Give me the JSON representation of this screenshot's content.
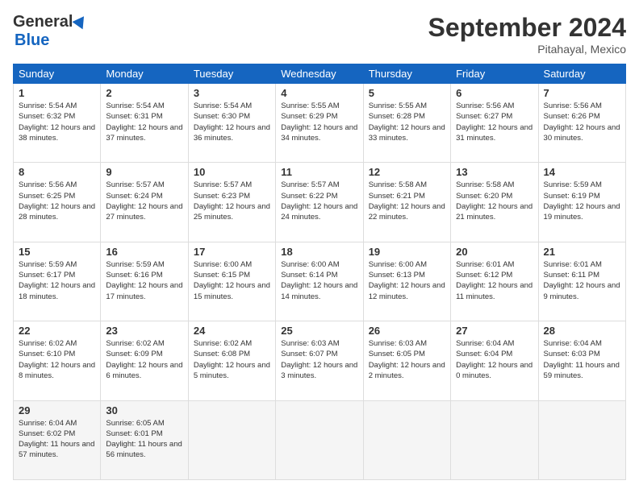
{
  "logo": {
    "general": "General",
    "blue": "Blue"
  },
  "title": "September 2024",
  "location": "Pitahayal, Mexico",
  "days_header": [
    "Sunday",
    "Monday",
    "Tuesday",
    "Wednesday",
    "Thursday",
    "Friday",
    "Saturday"
  ],
  "weeks": [
    [
      {
        "day": "1",
        "sunrise": "5:54 AM",
        "sunset": "6:32 PM",
        "daylight": "12 hours and 38 minutes."
      },
      {
        "day": "2",
        "sunrise": "5:54 AM",
        "sunset": "6:31 PM",
        "daylight": "12 hours and 37 minutes."
      },
      {
        "day": "3",
        "sunrise": "5:54 AM",
        "sunset": "6:30 PM",
        "daylight": "12 hours and 36 minutes."
      },
      {
        "day": "4",
        "sunrise": "5:55 AM",
        "sunset": "6:29 PM",
        "daylight": "12 hours and 34 minutes."
      },
      {
        "day": "5",
        "sunrise": "5:55 AM",
        "sunset": "6:28 PM",
        "daylight": "12 hours and 33 minutes."
      },
      {
        "day": "6",
        "sunrise": "5:56 AM",
        "sunset": "6:27 PM",
        "daylight": "12 hours and 31 minutes."
      },
      {
        "day": "7",
        "sunrise": "5:56 AM",
        "sunset": "6:26 PM",
        "daylight": "12 hours and 30 minutes."
      }
    ],
    [
      {
        "day": "8",
        "sunrise": "5:56 AM",
        "sunset": "6:25 PM",
        "daylight": "12 hours and 28 minutes."
      },
      {
        "day": "9",
        "sunrise": "5:57 AM",
        "sunset": "6:24 PM",
        "daylight": "12 hours and 27 minutes."
      },
      {
        "day": "10",
        "sunrise": "5:57 AM",
        "sunset": "6:23 PM",
        "daylight": "12 hours and 25 minutes."
      },
      {
        "day": "11",
        "sunrise": "5:57 AM",
        "sunset": "6:22 PM",
        "daylight": "12 hours and 24 minutes."
      },
      {
        "day": "12",
        "sunrise": "5:58 AM",
        "sunset": "6:21 PM",
        "daylight": "12 hours and 22 minutes."
      },
      {
        "day": "13",
        "sunrise": "5:58 AM",
        "sunset": "6:20 PM",
        "daylight": "12 hours and 21 minutes."
      },
      {
        "day": "14",
        "sunrise": "5:59 AM",
        "sunset": "6:19 PM",
        "daylight": "12 hours and 19 minutes."
      }
    ],
    [
      {
        "day": "15",
        "sunrise": "5:59 AM",
        "sunset": "6:17 PM",
        "daylight": "12 hours and 18 minutes."
      },
      {
        "day": "16",
        "sunrise": "5:59 AM",
        "sunset": "6:16 PM",
        "daylight": "12 hours and 17 minutes."
      },
      {
        "day": "17",
        "sunrise": "6:00 AM",
        "sunset": "6:15 PM",
        "daylight": "12 hours and 15 minutes."
      },
      {
        "day": "18",
        "sunrise": "6:00 AM",
        "sunset": "6:14 PM",
        "daylight": "12 hours and 14 minutes."
      },
      {
        "day": "19",
        "sunrise": "6:00 AM",
        "sunset": "6:13 PM",
        "daylight": "12 hours and 12 minutes."
      },
      {
        "day": "20",
        "sunrise": "6:01 AM",
        "sunset": "6:12 PM",
        "daylight": "12 hours and 11 minutes."
      },
      {
        "day": "21",
        "sunrise": "6:01 AM",
        "sunset": "6:11 PM",
        "daylight": "12 hours and 9 minutes."
      }
    ],
    [
      {
        "day": "22",
        "sunrise": "6:02 AM",
        "sunset": "6:10 PM",
        "daylight": "12 hours and 8 minutes."
      },
      {
        "day": "23",
        "sunrise": "6:02 AM",
        "sunset": "6:09 PM",
        "daylight": "12 hours and 6 minutes."
      },
      {
        "day": "24",
        "sunrise": "6:02 AM",
        "sunset": "6:08 PM",
        "daylight": "12 hours and 5 minutes."
      },
      {
        "day": "25",
        "sunrise": "6:03 AM",
        "sunset": "6:07 PM",
        "daylight": "12 hours and 3 minutes."
      },
      {
        "day": "26",
        "sunrise": "6:03 AM",
        "sunset": "6:05 PM",
        "daylight": "12 hours and 2 minutes."
      },
      {
        "day": "27",
        "sunrise": "6:04 AM",
        "sunset": "6:04 PM",
        "daylight": "12 hours and 0 minutes."
      },
      {
        "day": "28",
        "sunrise": "6:04 AM",
        "sunset": "6:03 PM",
        "daylight": "11 hours and 59 minutes."
      }
    ],
    [
      {
        "day": "29",
        "sunrise": "6:04 AM",
        "sunset": "6:02 PM",
        "daylight": "11 hours and 57 minutes."
      },
      {
        "day": "30",
        "sunrise": "6:05 AM",
        "sunset": "6:01 PM",
        "daylight": "11 hours and 56 minutes."
      },
      null,
      null,
      null,
      null,
      null
    ]
  ],
  "labels": {
    "sunrise": "Sunrise:",
    "sunset": "Sunset:",
    "daylight": "Daylight:"
  }
}
